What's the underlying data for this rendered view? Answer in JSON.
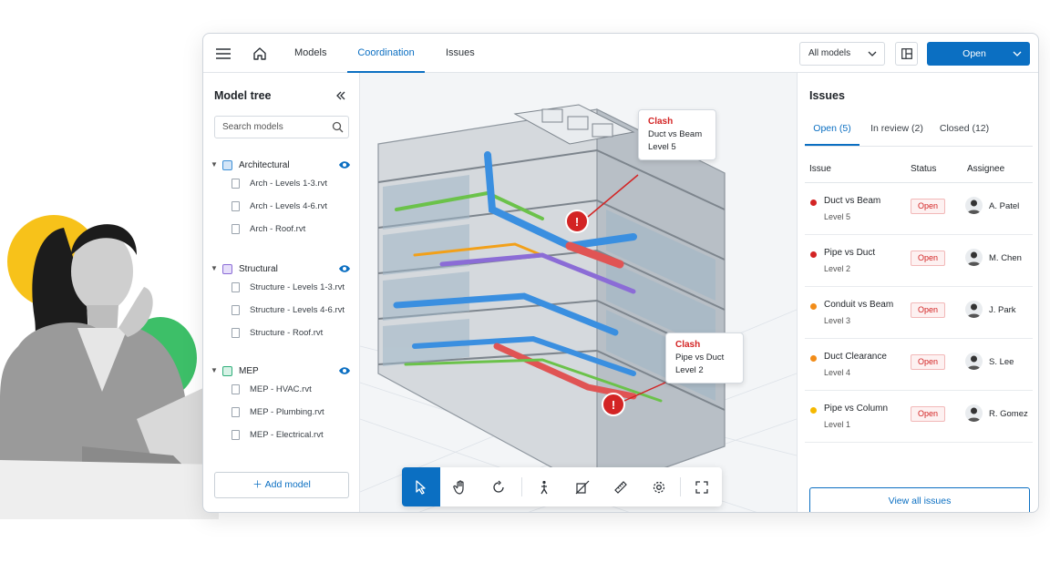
{
  "colors": {
    "accent": "#0b6fc2",
    "danger": "#d32424",
    "warning": "#f28c18",
    "caution": "#f5b800",
    "architectural": "#3d8fd6",
    "structural": "#8b6cd6",
    "mep": "#2fae7a"
  },
  "topbar": {
    "tabs": [
      {
        "label": "Models"
      },
      {
        "label": "Coordination"
      },
      {
        "label": "Issues"
      }
    ],
    "model_filter": "All models",
    "open_label": "Open"
  },
  "model_tree": {
    "title": "Model tree",
    "search_placeholder": "Search models",
    "groups": [
      {
        "name": "Architectural",
        "files": [
          "Arch - Levels 1-3.rvt",
          "Arch - Levels 4-6.rvt",
          "Arch - Roof.rvt"
        ]
      },
      {
        "name": "Structural",
        "files": [
          "Structure - Levels 1-3.rvt",
          "Structure - Levels 4-6.rvt",
          "Structure - Roof.rvt"
        ]
      },
      {
        "name": "MEP",
        "files": [
          "MEP - HVAC.rvt",
          "MEP - Plumbing.rvt",
          "MEP - Electrical.rvt"
        ]
      }
    ],
    "add_model_label": "Add model"
  },
  "viewport": {
    "callouts": [
      {
        "title": "Clash",
        "line1": "Duct vs Beam",
        "line2": "Level 5"
      },
      {
        "title": "Clash",
        "line1": "Pipe vs Duct",
        "line2": "Level 2"
      }
    ]
  },
  "issues": {
    "title": "Issues",
    "tabs": [
      {
        "label": "Open (5)"
      },
      {
        "label": "In review (2)"
      },
      {
        "label": "Closed (12)"
      }
    ],
    "columns": [
      "Issue",
      "Status",
      "Assignee"
    ],
    "rows": [
      {
        "name": "Duct vs Beam",
        "level": "Level 5",
        "status": "Open",
        "assignee": "A. Patel",
        "severity": "#d32424"
      },
      {
        "name": "Pipe vs Duct",
        "level": "Level 2",
        "status": "Open",
        "assignee": "M. Chen",
        "severity": "#d32424"
      },
      {
        "name": "Conduit vs Beam",
        "level": "Level 3",
        "status": "Open",
        "assignee": "J. Park",
        "severity": "#f28c18"
      },
      {
        "name": "Duct Clearance",
        "level": "Level 4",
        "status": "Open",
        "assignee": "S. Lee",
        "severity": "#f28c18"
      },
      {
        "name": "Pipe vs Column",
        "level": "Level 1",
        "status": "Open",
        "assignee": "R. Gomez",
        "severity": "#f5b800"
      }
    ],
    "view_all_label": "View all issues"
  }
}
